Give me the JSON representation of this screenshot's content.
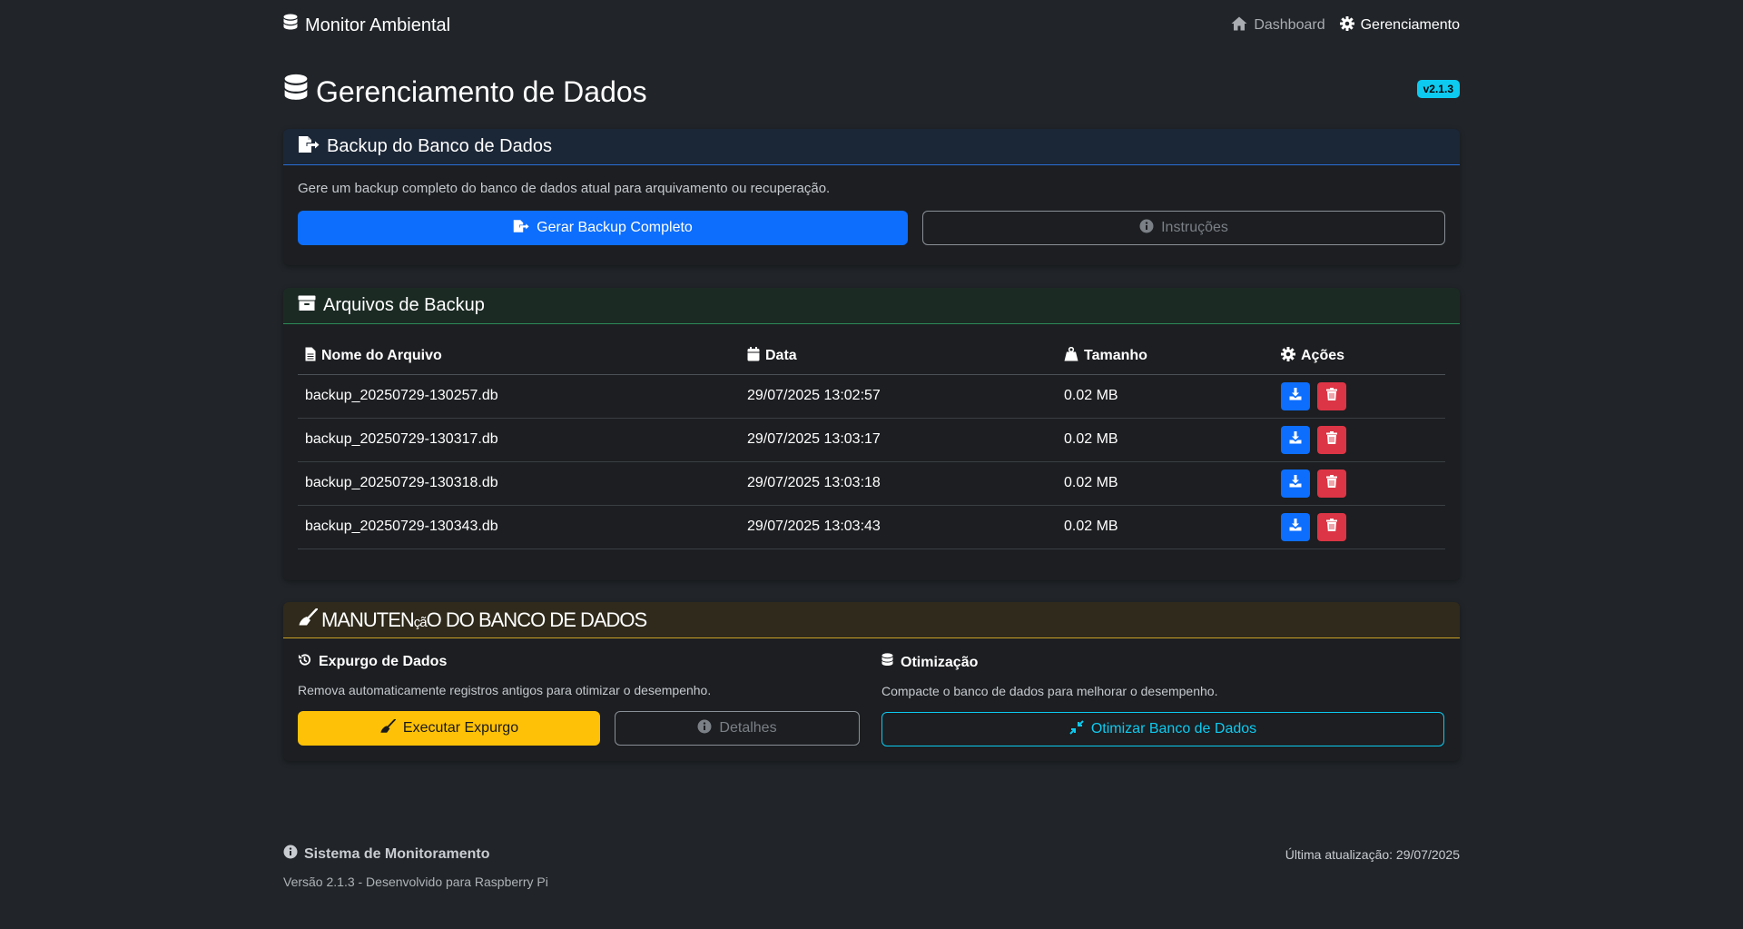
{
  "navbar": {
    "brand": "Monitor Ambiental",
    "links": [
      {
        "label": "Dashboard",
        "icon": "home-icon",
        "active": false
      },
      {
        "label": "Gerenciamento",
        "icon": "gear-icon",
        "active": true
      }
    ]
  },
  "header": {
    "title": "Gerenciamento de Dados",
    "version": "v2.1.3"
  },
  "backup_card": {
    "title": "Backup do Banco de Dados",
    "description": "Gere um backup completo do banco de dados atual para arquivamento ou recuperação.",
    "generate_button": "Gerar Backup Completo",
    "instructions_button": "Instruções"
  },
  "files_card": {
    "title": "Arquivos de Backup",
    "columns": [
      "Nome do Arquivo",
      "Data",
      "Tamanho",
      "Ações"
    ],
    "rows": [
      {
        "name": "backup_20250729-130257.db",
        "date": "29/07/2025 13:02:57",
        "size": "0.02 MB"
      },
      {
        "name": "backup_20250729-130317.db",
        "date": "29/07/2025 13:03:17",
        "size": "0.02 MB"
      },
      {
        "name": "backup_20250729-130318.db",
        "date": "29/07/2025 13:03:18",
        "size": "0.02 MB"
      },
      {
        "name": "backup_20250729-130343.db",
        "date": "29/07/2025 13:03:43",
        "size": "0.02 MB"
      }
    ]
  },
  "maintenance_card": {
    "title_a": "MANUTEN",
    "title_b": "çã",
    "title_c": "O DO BANCO DE DADOS",
    "purge": {
      "title": "Expurgo de Dados",
      "description": "Remova automaticamente registros antigos para otimizar o desempenho.",
      "execute_button": "Executar Expurgo",
      "details_button": "Detalhes"
    },
    "optimize": {
      "title": "Otimização",
      "description": "Compacte o banco de dados para melhorar o desempenho.",
      "button": "Otimizar Banco de Dados"
    }
  },
  "footer": {
    "title": "Sistema de Monitoramento",
    "subtitle": "Versão 2.1.3 - Desenvolvido para Raspberry Pi",
    "last_update": "Última atualização: 29/07/2025"
  },
  "colors": {
    "background": "#212529",
    "primary": "#0d6efd",
    "danger": "#dc3545",
    "warning": "#ffc107",
    "info": "#0dcaf0"
  }
}
